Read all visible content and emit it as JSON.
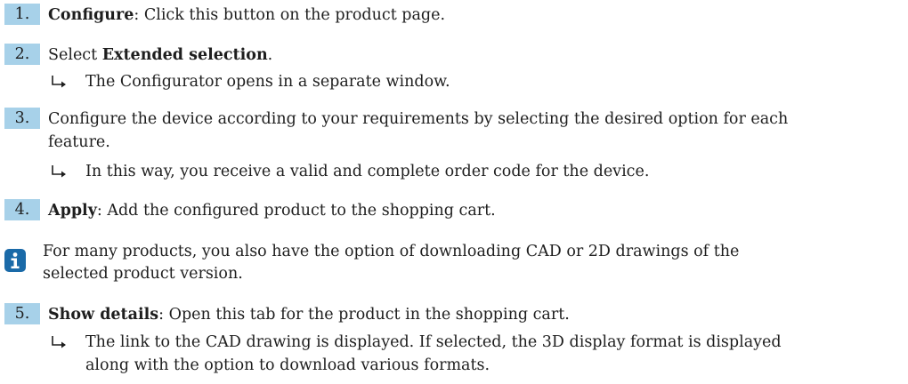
{
  "steps": [
    {
      "num": "1.",
      "bold": "Configure",
      "rest": ": Click this button on the product page."
    },
    {
      "num": "2.",
      "pre": "Select ",
      "bold": "Extended selection",
      "post": "."
    },
    {
      "num": "3.",
      "line1": "Configure the device according to your requirements by selecting the desired option for each",
      "line2": "feature."
    },
    {
      "num": "4.",
      "bold": "Apply",
      "rest": ": Add the configured product to the shopping cart."
    },
    {
      "num": "5.",
      "bold": "Show details",
      "rest": ": Open this tab for the product in the shopping cart."
    }
  ],
  "results": {
    "step2": "The Configurator opens in a separate window.",
    "step3": "In this way, you receive a valid and complete order code for the device.",
    "step5_line1": "The link to the CAD drawing is displayed. If selected, the 3D display format is displayed",
    "step5_line2": "along with the option to download various formats."
  },
  "info": {
    "icon": "info-icon",
    "line1": "For many products, you also have the option of downloading CAD or 2D drawings of the",
    "line2": "selected product version."
  },
  "colors": {
    "step_badge": "#a7d1e9",
    "info_icon": "#1a6aa8",
    "text": "#1e1e1e"
  }
}
